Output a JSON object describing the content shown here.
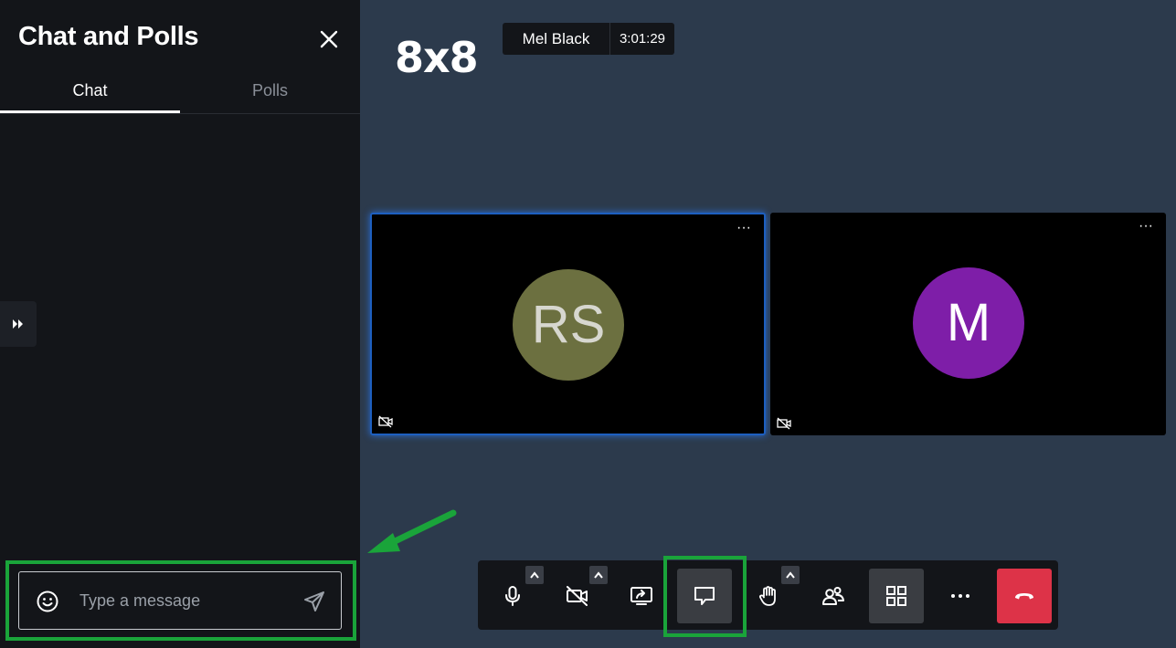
{
  "sidebar": {
    "title": "Chat and Polls",
    "tabs": [
      {
        "label": "Chat",
        "active": true
      },
      {
        "label": "Polls",
        "active": false
      }
    ],
    "composer": {
      "placeholder": "Type a message",
      "value": ""
    }
  },
  "header": {
    "logo": "8x8",
    "speaker_name": "Mel Black",
    "timer": "3:01:29"
  },
  "tiles": [
    {
      "initials": "RS",
      "avatar_color": "#6c7040",
      "more_label": "···",
      "active_speaker": true
    },
    {
      "initials": "M",
      "avatar_color": "#7e1ea8",
      "more_label": "···",
      "active_speaker": false
    }
  ],
  "toolbar": {
    "buttons": [
      {
        "name": "microphone",
        "icon": "microphone-icon"
      },
      {
        "name": "camera",
        "icon": "camera-off-icon"
      },
      {
        "name": "share-screen",
        "icon": "share-screen-icon"
      },
      {
        "name": "chat",
        "icon": "chat-icon",
        "active": true
      },
      {
        "name": "raise-hand",
        "icon": "hand-icon"
      },
      {
        "name": "participants",
        "icon": "participants-icon"
      },
      {
        "name": "tile-view",
        "icon": "grid-icon"
      },
      {
        "name": "more",
        "icon": "more-icon"
      },
      {
        "name": "hang-up",
        "icon": "hang-up-icon"
      }
    ],
    "more_label": "···"
  },
  "colors": {
    "highlight": "#1aa43a",
    "hangup": "#dd3348",
    "sidebar_bg": "#131519",
    "stage_bg": "#2c3a4c"
  }
}
